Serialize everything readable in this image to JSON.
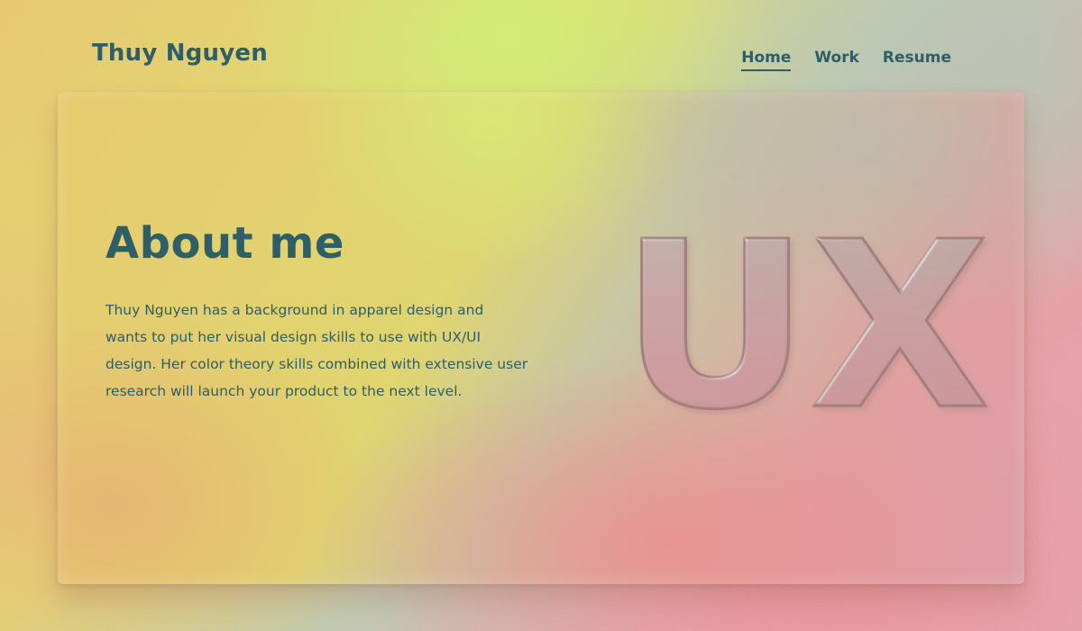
{
  "header": {
    "brand": "Thuy Nguyen",
    "nav": [
      {
        "label": "Home",
        "active": true
      },
      {
        "label": "Work",
        "active": false
      },
      {
        "label": "Resume",
        "active": false
      }
    ]
  },
  "about": {
    "title": "About me",
    "body": "Thuy Nguyen has a background in apparel design and wants to put her visual design skills to use with UX/UI design. Her color theory skills combined with extensive user research will launch your product to the next level.",
    "art_text": "UX"
  },
  "colors": {
    "text_primary": "#2e5e66"
  }
}
